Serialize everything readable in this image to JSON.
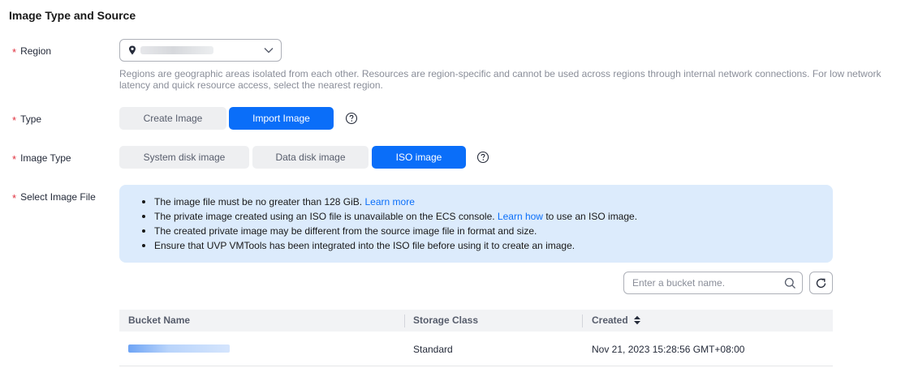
{
  "section": {
    "title": "Image Type and Source"
  },
  "region": {
    "label": "Region",
    "selected_value": "",
    "help": "Regions are geographic areas isolated from each other. Resources are region-specific and cannot be used across regions through internal network connections. For low network latency and quick resource access, select the nearest region."
  },
  "type": {
    "label": "Type",
    "options": [
      "Create Image",
      "Import Image"
    ],
    "selected": "Import Image"
  },
  "image_type": {
    "label": "Image Type",
    "options": [
      "System disk image",
      "Data disk image",
      "ISO image"
    ],
    "selected": "ISO image"
  },
  "select_image_file": {
    "label": "Select Image File",
    "notes": [
      {
        "text": "The image file must be no greater than 128 GiB.",
        "link": "Learn more",
        "after": ""
      },
      {
        "text": "The private image created using an ISO file is unavailable on the ECS console.",
        "link": "Learn how",
        "after": "to use an ISO image."
      },
      {
        "text": "The created private image may be different from the source image file in format and size.",
        "link": "",
        "after": ""
      },
      {
        "text": "Ensure that UVP VMTools has been integrated into the ISO file before using it to create an image.",
        "link": "",
        "after": ""
      }
    ]
  },
  "search": {
    "placeholder": "Enter a bucket name."
  },
  "table": {
    "columns": [
      "Bucket Name",
      "Storage Class",
      "Created"
    ],
    "rows": [
      {
        "bucket_name": "",
        "storage_class": "Standard",
        "created": "Nov 21, 2023 15:28:56 GMT+08:00"
      }
    ]
  },
  "colors": {
    "accent": "#0a6ef9",
    "required": "#e0303e",
    "info_bg": "#dcebfc"
  }
}
